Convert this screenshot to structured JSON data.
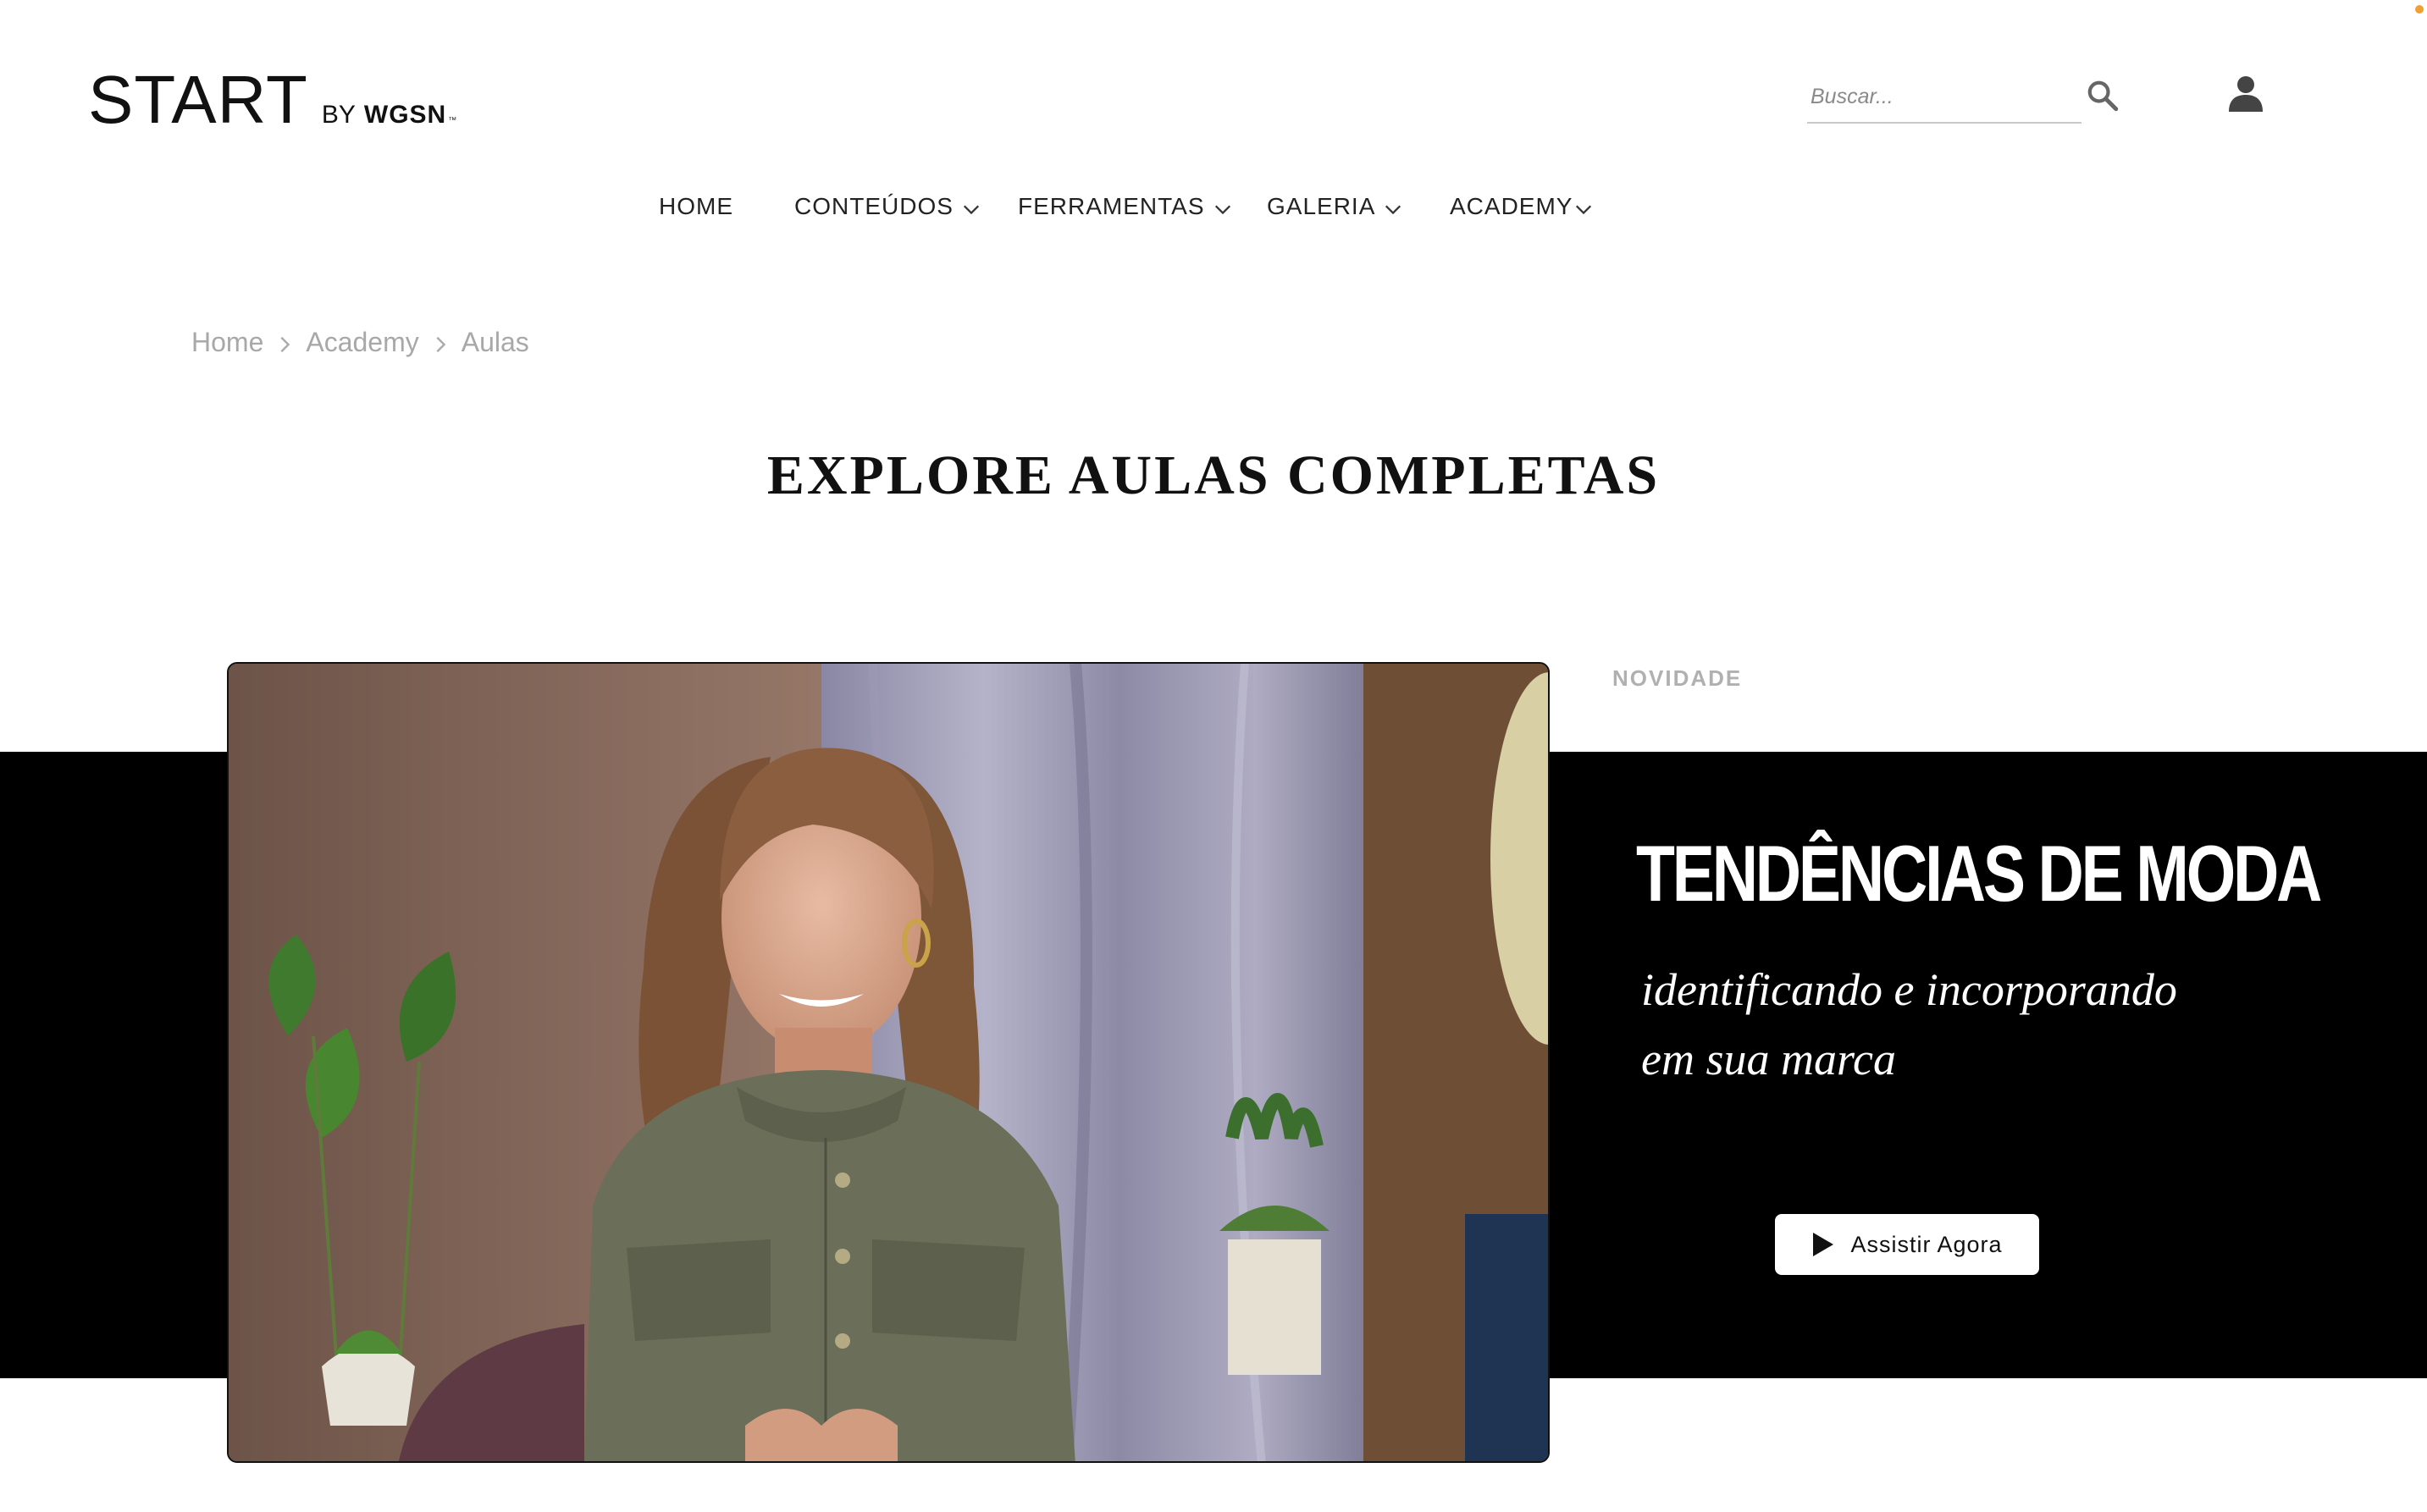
{
  "header": {
    "logo": {
      "start": "START",
      "by": "BY",
      "brand": "WGSN",
      "tm": "™"
    },
    "search": {
      "placeholder": "Buscar..."
    },
    "icons": {
      "search": "search-icon",
      "user": "user-icon"
    },
    "accent_dot_color": "#f0a030"
  },
  "nav": {
    "items": [
      {
        "label": "HOME",
        "has_dropdown": false
      },
      {
        "label": "CONTEÚDOS",
        "has_dropdown": true
      },
      {
        "label": "FERRAMENTAS",
        "has_dropdown": true
      },
      {
        "label": "GALERIA",
        "has_dropdown": true
      },
      {
        "label": "ACADEMY",
        "has_dropdown": true
      }
    ]
  },
  "breadcrumb": {
    "items": [
      "Home",
      "Academy",
      "Aulas"
    ]
  },
  "page": {
    "title": "EXPLORE AULAS COMPLETAS"
  },
  "featured": {
    "tag": "NOVIDADE",
    "heading": "TENDÊNCIAS DE MODA",
    "subtitle_line1": "identificando e incorporando",
    "subtitle_line2": "em sua marca",
    "button_label": "Assistir Agora",
    "band_color": "#000000",
    "button_color": "#ffffff"
  }
}
